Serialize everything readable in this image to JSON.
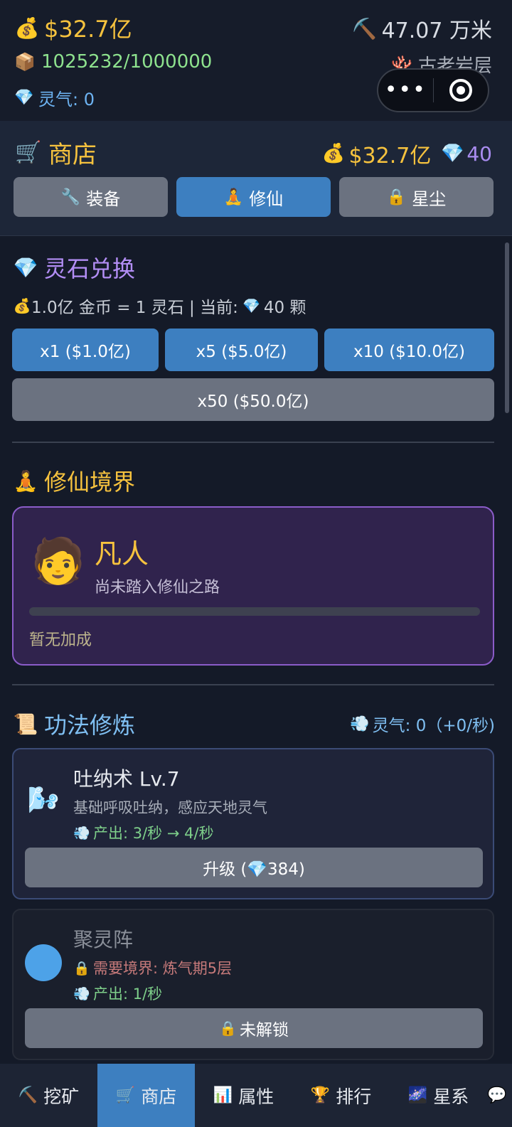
{
  "top": {
    "gold_icon": "money-bag-icon",
    "gold": "$32.7亿",
    "depth_icon": "pickaxe-icon",
    "depth": "47.07 万米",
    "capacity_icon": "package-icon",
    "capacity": "1025232/1000000",
    "layer_icon": "coral-icon",
    "layer": "古老岩层",
    "qi_icon": "gem-icon",
    "qi": "灵气: 0"
  },
  "shop": {
    "title": "商店",
    "gold": "$32.7亿",
    "gems": "40",
    "tabs": [
      {
        "label": "装备",
        "icon": "wrench-icon",
        "active": false
      },
      {
        "label": "修仙",
        "icon": "meditation-icon",
        "active": true
      },
      {
        "label": "星尘",
        "icon": "lock-icon",
        "active": false
      }
    ]
  },
  "exchange": {
    "title": "灵石兑换",
    "rate_prefix": "1.0亿 金币 = 1 灵石 | 当前:",
    "rate_suffix": "40 颗",
    "buttons": [
      "x1 ($1.0亿)",
      "x5 ($5.0亿)",
      "x10 ($10.0亿)",
      "x50 ($50.0亿)"
    ]
  },
  "realm": {
    "title": "修仙境界",
    "name": "凡人",
    "desc": "尚未踏入修仙之路",
    "progress": 0,
    "bonus": "暂无加成"
  },
  "skills": {
    "title": "功法修炼",
    "qi_status": "灵气: 0（+0/秒)",
    "items": [
      {
        "name": "吐纳术 Lv.7",
        "desc": "基础呼吸吐纳，感应天地灵气",
        "prod": "产出: 3/秒 → 4/秒",
        "button": "升级 (💎384)",
        "locked": false
      },
      {
        "name": "聚灵阵",
        "req": "需要境界: 炼气期5层",
        "prod": "产出: 1/秒",
        "button": "未解锁",
        "locked": true
      }
    ]
  },
  "nav": [
    {
      "label": "挖矿",
      "icon": "pickaxe-icon",
      "active": false
    },
    {
      "label": "商店",
      "icon": "cart-icon",
      "active": true
    },
    {
      "label": "属性",
      "icon": "chart-icon",
      "active": false
    },
    {
      "label": "排行",
      "icon": "trophy-icon",
      "active": false
    },
    {
      "label": "星系",
      "icon": "galaxy-icon",
      "active": false
    }
  ],
  "colors": {
    "gold": "#f6c23e",
    "accent": "#3d7fc0",
    "realm_border": "#8b5cc9",
    "green": "#8ee28e"
  }
}
